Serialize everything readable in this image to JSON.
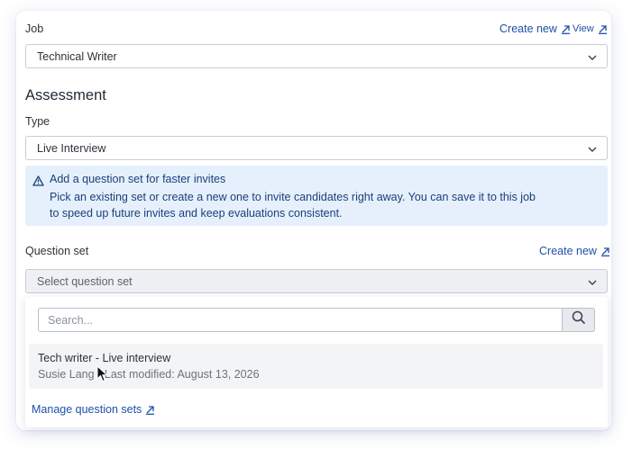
{
  "job": {
    "label": "Job",
    "create_new": "Create new",
    "view": "View",
    "selected": "Technical Writer"
  },
  "assessment": {
    "title": "Assessment",
    "type_label": "Type",
    "type_selected": "Live Interview"
  },
  "banner": {
    "title": "Add a question set for faster invites",
    "body": "Pick an existing set or create a new one to invite candidates right away. You can save it to this job to speed up future invites and keep evaluations consistent."
  },
  "question_set": {
    "label": "Question set",
    "create_new": "Create new",
    "placeholder": "Select question set"
  },
  "dropdown": {
    "search_placeholder": "Search...",
    "options": [
      {
        "title": "Tech writer - Live interview",
        "meta": "Susie Lang • Last modified: August 13, 2026"
      }
    ],
    "manage_link": "Manage question sets"
  },
  "icons": {
    "external": "external-link-icon",
    "chevron": "chevron-down-icon",
    "warning": "warning-icon",
    "search": "search-icon"
  },
  "colors": {
    "link": "#1f4fa8",
    "banner_bg": "#e6f0fc",
    "banner_text": "#1b3f7a"
  }
}
